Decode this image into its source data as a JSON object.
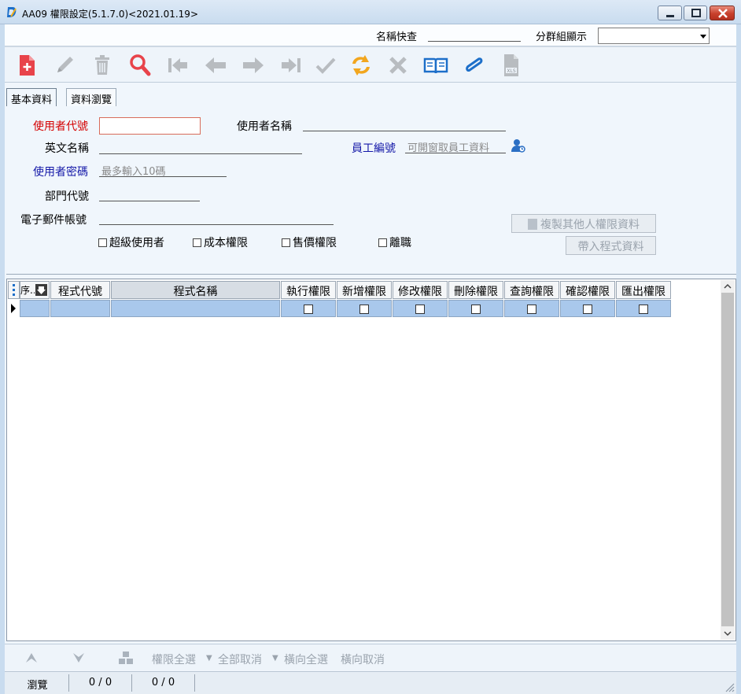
{
  "window": {
    "title": "AA09 權限設定(5.1.7.0)<2021.01.19>"
  },
  "quickbar": {
    "name_search_label": "名稱快查",
    "group_display_label": "分群組顯示",
    "group_display_value": ""
  },
  "tabs": [
    {
      "label": "基本資料",
      "active": true
    },
    {
      "label": "資料瀏覽",
      "active": false
    }
  ],
  "form": {
    "user_code_label": "使用者代號",
    "user_code_value": "",
    "user_name_label": "使用者名稱",
    "user_name_value": "",
    "english_name_label": "英文名稱",
    "english_name_value": "",
    "employee_no_label": "員工編號",
    "employee_no_placeholder": "可開窗取員工資料",
    "password_label": "使用者密碼",
    "password_placeholder": "最多輸入10碼",
    "dept_code_label": "部門代號",
    "dept_code_value": "",
    "email_label": "電子郵件帳號",
    "email_value": "",
    "copy_button": "複製其他人權限資料",
    "import_button": "帶入程式資料",
    "checkboxes": [
      {
        "label": "超級使用者",
        "checked": false
      },
      {
        "label": "成本權限",
        "checked": false
      },
      {
        "label": "售價權限",
        "checked": false
      },
      {
        "label": "離職",
        "checked": false
      }
    ]
  },
  "grid": {
    "columns": [
      "序...",
      "程式代號",
      "程式名稱",
      "執行權限",
      "新增權限",
      "修改權限",
      "刪除權限",
      "查詢權限",
      "確認權限",
      "匯出權限"
    ],
    "rows": [
      {
        "seq": "",
        "program_code": "",
        "program_name": "",
        "exec": false,
        "add": false,
        "edit": false,
        "delete": false,
        "query": false,
        "confirm": false,
        "export": false
      }
    ]
  },
  "bottombar": {
    "select_all_perm": "權限全選",
    "cancel_all": "全部取消",
    "select_row": "橫向全選",
    "cancel_row": "橫向取消"
  },
  "status": {
    "mode": "瀏覽",
    "count1": "0 / 0",
    "count2": "0 / 0"
  },
  "colors": {
    "required_label": "#d40000",
    "linked_label": "#1418a8",
    "grid_row": "#a9c8ec",
    "accent": "#0c54c8"
  }
}
